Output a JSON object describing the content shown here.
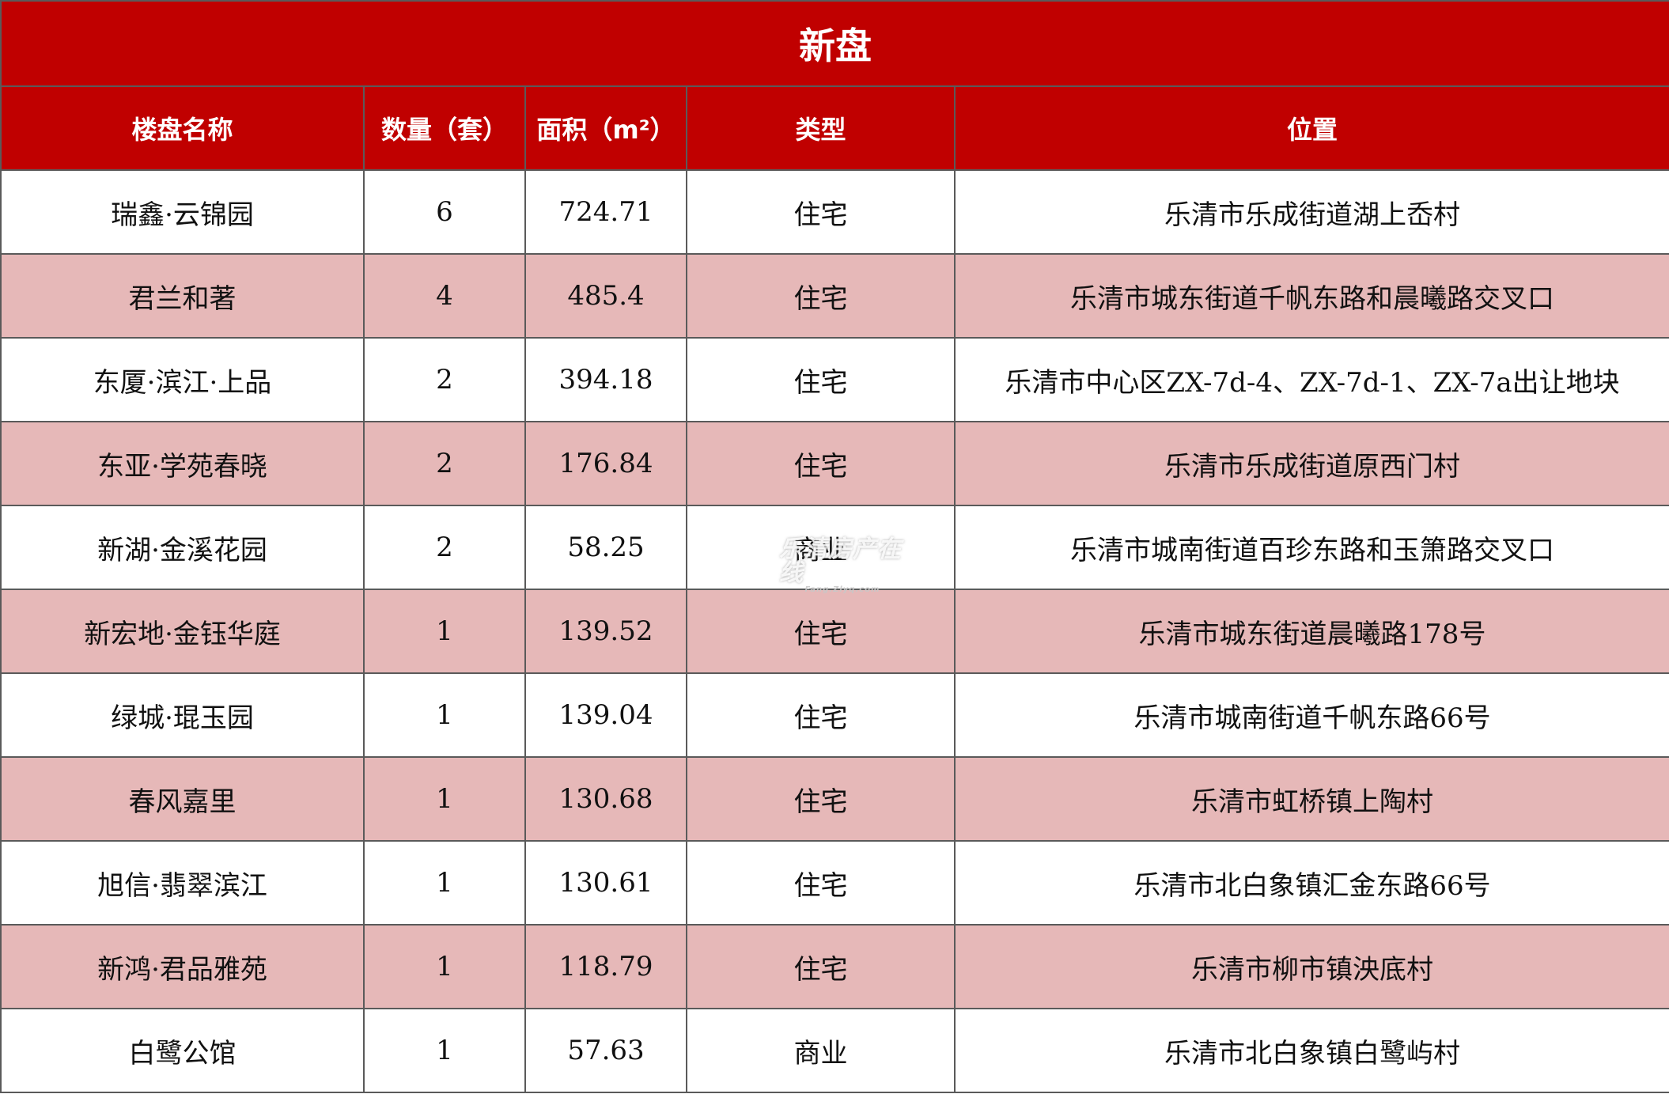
{
  "table": {
    "title": "新盘",
    "headers": [
      "楼盘名称",
      "数量（套）",
      "面积（m²）",
      "类型",
      "位置"
    ],
    "rows": [
      {
        "name": "瑞鑫·云锦园",
        "count": "6",
        "area": "724.71",
        "type": "住宅",
        "location": "乐清市乐成街道湖上岙村"
      },
      {
        "name": "君兰和著",
        "count": "4",
        "area": "485.4",
        "type": "住宅",
        "location": "乐清市城东街道千帆东路和晨曦路交叉口"
      },
      {
        "name": "东厦·滨江·上品",
        "count": "2",
        "area": "394.18",
        "type": "住宅",
        "location": "乐清市中心区ZX-7d-4、ZX-7d-1、ZX-7a出让地块"
      },
      {
        "name": "东亚·学苑春晓",
        "count": "2",
        "area": "176.84",
        "type": "住宅",
        "location": "乐清市乐成街道原西门村"
      },
      {
        "name": "新湖·金溪花园",
        "count": "2",
        "area": "58.25",
        "type": "商业",
        "location": "乐清市城南街道百珍东路和玉箫路交叉口"
      },
      {
        "name": "新宏地·金钰华庭",
        "count": "1",
        "area": "139.52",
        "type": "住宅",
        "location": "乐清市城东街道晨曦路178号"
      },
      {
        "name": "绿城·琨玉园",
        "count": "1",
        "area": "139.04",
        "type": "住宅",
        "location": "乐清市城南街道千帆东路66号"
      },
      {
        "name": "春风嘉里",
        "count": "1",
        "area": "130.68",
        "type": "住宅",
        "location": "乐清市虹桥镇上陶村"
      },
      {
        "name": "旭信·翡翠滨江",
        "count": "1",
        "area": "130.61",
        "type": "住宅",
        "location": "乐清市北白象镇汇金东路66号"
      },
      {
        "name": "新鸿·君品雅苑",
        "count": "1",
        "area": "118.79",
        "type": "住宅",
        "location": "乐清市柳市镇泱底村"
      },
      {
        "name": "白鹭公馆",
        "count": "1",
        "area": "57.63",
        "type": "商业",
        "location": "乐清市北白象镇白鹭屿村"
      }
    ]
  },
  "watermark": {
    "text": "乐清房产在线",
    "sub": "Fang.Zlyq.com"
  },
  "colors": {
    "header_bg": "#c00000",
    "header_text": "#ffffff",
    "stripe_bg": "#e6b8b8",
    "row_bg": "#ffffff"
  }
}
